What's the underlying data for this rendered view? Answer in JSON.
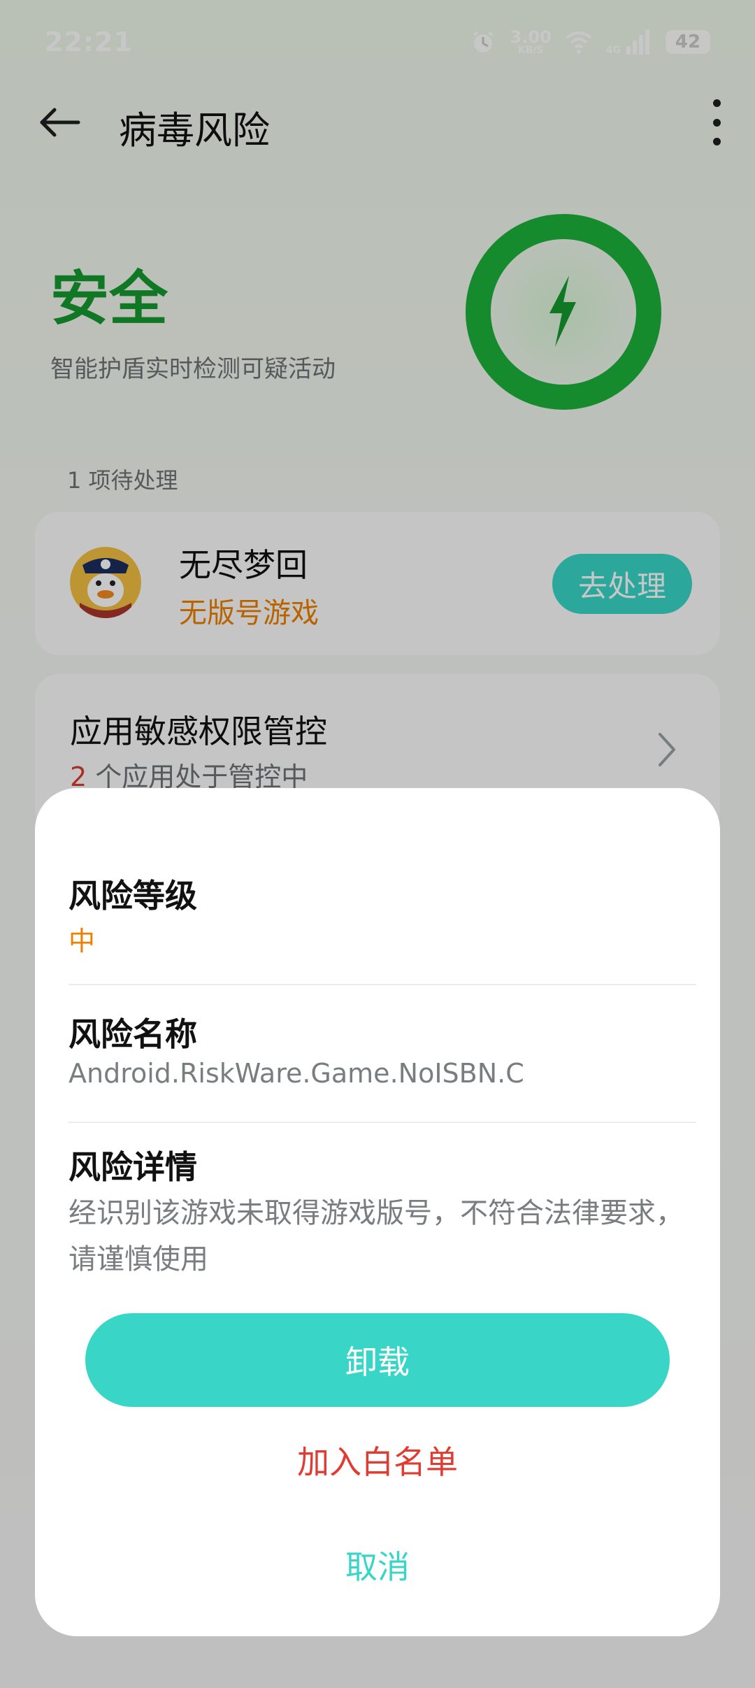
{
  "status_bar": {
    "time": "22:21",
    "speed_value": "3.00",
    "speed_unit": "KB/S",
    "network_label": "4G",
    "battery": "42"
  },
  "app_bar": {
    "title": "病毒风险"
  },
  "status": {
    "title": "安全",
    "subtitle": "智能护盾实时检测可疑活动"
  },
  "pending": {
    "label": "1 项待处理",
    "app_name": "无尽梦回",
    "app_tag": "无版号游戏",
    "action_label": "去处理"
  },
  "permissions": {
    "title": "应用敏感权限管控",
    "count": "2",
    "subtitle_suffix": " 个应用处于管控中"
  },
  "sheet": {
    "risk_level_label": "风险等级",
    "risk_level_value": "中",
    "risk_name_label": "风险名称",
    "risk_name_value": "Android.RiskWare.Game.NoISBN.C",
    "risk_detail_label": "风险详情",
    "risk_detail_value": "经识别该游戏未取得游戏版号，不符合法律要求，请谨慎使用",
    "uninstall_label": "卸载",
    "whitelist_label": "加入白名单",
    "cancel_label": "取消"
  },
  "colors": {
    "safe_green": "#159a2f",
    "accent_teal": "#39d6c8",
    "warning_orange": "#ee7f00",
    "danger_red": "#e13c32"
  }
}
